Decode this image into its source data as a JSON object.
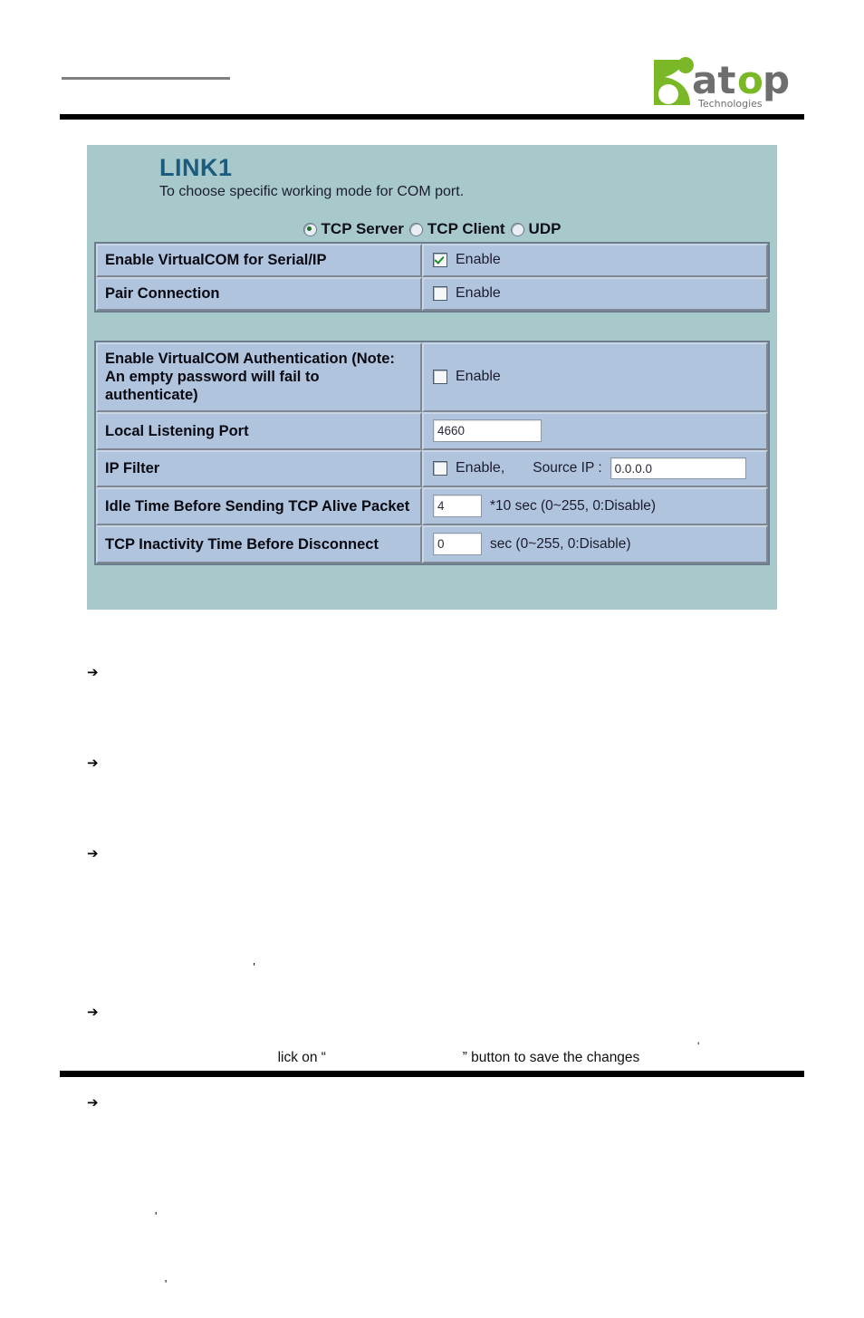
{
  "document": {
    "header_rule_present": true,
    "logo": {
      "brand": "atop",
      "tagline": "Technologies",
      "accent_color": "#7ab828",
      "text_color": "#6e6e6e"
    }
  },
  "panel": {
    "title": "LINK1",
    "subtitle": "To choose specific working mode for COM port.",
    "background_color": "#a7c9cc",
    "title_color": "#1b5b7e",
    "mode_options": [
      {
        "label": "TCP Server",
        "selected": true
      },
      {
        "label": "TCP Client",
        "selected": false
      },
      {
        "label": "UDP",
        "selected": false
      }
    ],
    "group1_rows": [
      {
        "label": "Enable VirtualCOM for Serial/IP",
        "control": "checkbox",
        "checkbox_label": "Enable",
        "checked": true
      },
      {
        "label": "Pair Connection",
        "control": "checkbox",
        "checkbox_label": "Enable",
        "checked": false
      }
    ],
    "group2_rows": [
      {
        "label": "Enable VirtualCOM Authentication (Note: An empty password will fail to authenticate)",
        "control": "checkbox",
        "checkbox_label": "Enable",
        "checked": false
      },
      {
        "label": "Local Listening Port",
        "control": "text",
        "value": "4660"
      },
      {
        "label": "IP Filter",
        "control": "checkbox-ip",
        "checkbox_label": "Enable,",
        "checked": false,
        "ip_label": "Source IP :",
        "ip_value": "0.0.0.0"
      },
      {
        "label": "Idle Time Before Sending TCP Alive Packet",
        "control": "text-hint",
        "value": "4",
        "hint": "*10 sec (0~255, 0:Disable)"
      },
      {
        "label": "TCP Inactivity Time Before Disconnect",
        "control": "text-hint",
        "value": "0",
        "hint": "sec (0~255, 0:Disable)"
      }
    ]
  },
  "body": {
    "arrow_glyph": "➔",
    "lines": [
      {
        "arrow": true,
        "text": ""
      },
      {
        "arrow": true,
        "text": ""
      },
      {
        "arrow": true,
        "text": ""
      },
      {
        "arrow": false,
        "text": "                                              '"
      },
      {
        "arrow": true,
        "text": "                                     lick on “                                   ” button to save the changes"
      },
      {
        "arrow": true,
        "text": ""
      },
      {
        "arrow": false,
        "text": "                '"
      },
      {
        "arrow": false,
        "text": "                   '"
      }
    ]
  },
  "footer": {
    "stray_mark": "'"
  }
}
